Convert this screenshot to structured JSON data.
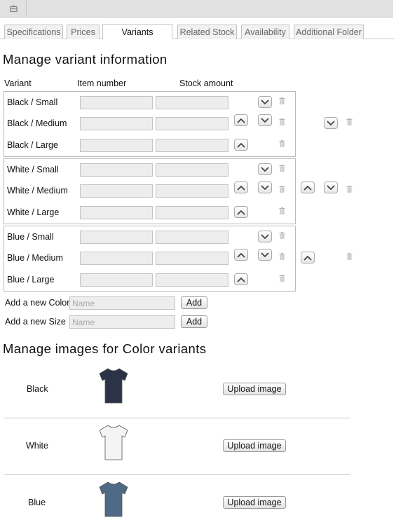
{
  "tabs": [
    {
      "label": "Specifications",
      "active": false
    },
    {
      "label": "Prices",
      "active": false
    },
    {
      "label": "Variants",
      "active": true
    },
    {
      "label": "Related Stock",
      "active": false
    },
    {
      "label": "Availability",
      "active": false
    },
    {
      "label": "Additional Folder",
      "active": false
    }
  ],
  "variants_section": {
    "title": "Manage variant information",
    "columns": {
      "variant": "Variant",
      "item_number": "Item number",
      "stock_amount": "Stock amount"
    },
    "groups": [
      {
        "color": "Black",
        "rows": [
          {
            "label": "Black / Small",
            "item_number": "",
            "stock_amount": ""
          },
          {
            "label": "Black / Medium",
            "item_number": "",
            "stock_amount": ""
          },
          {
            "label": "Black / Large",
            "item_number": "",
            "stock_amount": ""
          }
        ]
      },
      {
        "color": "White",
        "rows": [
          {
            "label": "White / Small",
            "item_number": "",
            "stock_amount": ""
          },
          {
            "label": "White / Medium",
            "item_number": "",
            "stock_amount": ""
          },
          {
            "label": "White / Large",
            "item_number": "",
            "stock_amount": ""
          }
        ]
      },
      {
        "color": "Blue",
        "rows": [
          {
            "label": "Blue / Small",
            "item_number": "",
            "stock_amount": ""
          },
          {
            "label": "Blue / Medium",
            "item_number": "",
            "stock_amount": ""
          },
          {
            "label": "Blue / Large",
            "item_number": "",
            "stock_amount": ""
          }
        ]
      }
    ],
    "add_color": {
      "label": "Add a new Color",
      "placeholder": "Name",
      "value": "",
      "button": "Add"
    },
    "add_size": {
      "label": "Add a new Size",
      "placeholder": "Name",
      "value": "",
      "button": "Add"
    }
  },
  "images_section": {
    "title": "Manage images for Color variants",
    "items": [
      {
        "color": "Black",
        "button": "Upload image",
        "shirt_color": "#2b3447"
      },
      {
        "color": "White",
        "button": "Upload image",
        "shirt_color": "#f4f4f4"
      },
      {
        "color": "Blue",
        "button": "Upload image",
        "shirt_color": "#4f6a86"
      }
    ]
  },
  "icons": {
    "top": "window-icon",
    "move_up": "chevron-up-icon",
    "move_down": "chevron-down-icon",
    "delete": "trash-icon",
    "product": "t-shirt-icon"
  },
  "colors": {
    "topbar": "#e1e1e1",
    "field": "#ededed",
    "border": "#b9b9b9"
  }
}
